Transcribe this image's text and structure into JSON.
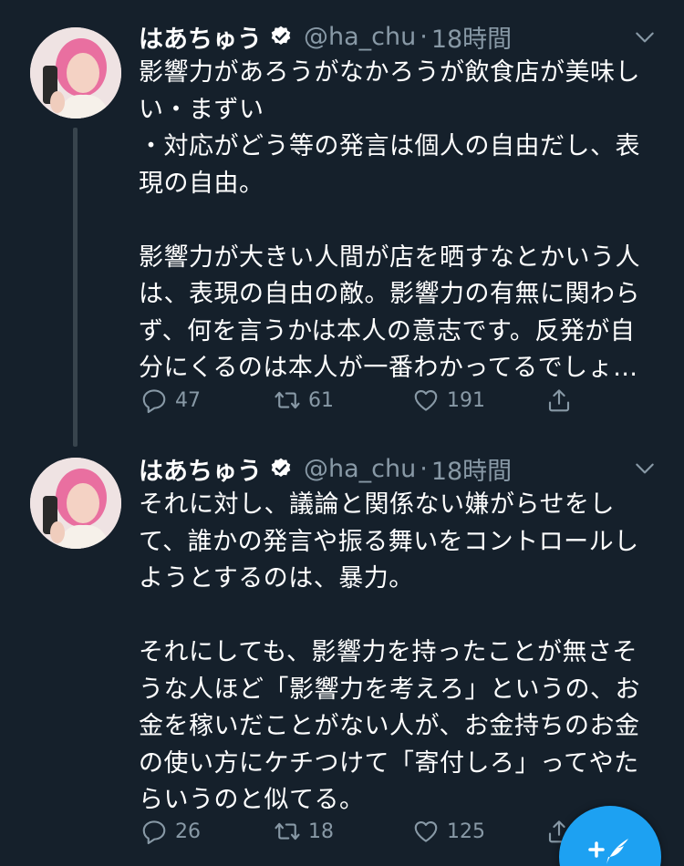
{
  "tweets": [
    {
      "display_name": "はあちゅう",
      "handle": "@ha_chu",
      "separator": "·",
      "time": "18時間",
      "text": "影響力があろうがなかろうが飲食店が美味しい・まずい\n・対応がどう等の発言は個人の自由だし、表現の自由。\n\n影響力が大きい人間が店を晒すなとかいう人は、表現の自由の敵。影響力の有無に関わらず、何を言うかは本人の意志です。反発が自分にくるのは本人が一番わかってるでしょ…",
      "reply_count": "47",
      "retweet_count": "61",
      "like_count": "191"
    },
    {
      "display_name": "はあちゅう",
      "handle": "@ha_chu",
      "separator": "·",
      "time": "18時間",
      "text": "それに対し、議論と関係ない嫌がらせをして、誰かの発言や振る舞いをコントロールしようとするのは、暴力。\n\nそれにしても、影響力を持ったことが無さそうな人ほど「影響力を考えろ」というの、お金を稼いだことがない人が、お金持ちのお金の使い方にケチつけて「寄付しろ」ってやたらいうのと似てる。",
      "reply_count": "26",
      "retweet_count": "18",
      "like_count": "125"
    }
  ],
  "icons": {
    "verified": "verified-badge-icon",
    "chevron": "chevron-down-icon",
    "reply": "reply-icon",
    "retweet": "retweet-icon",
    "like": "heart-icon",
    "share": "share-icon",
    "compose": "compose-tweet-icon"
  },
  "colors": {
    "background": "#15202b",
    "secondary_text": "#8899a6",
    "accent": "#1da1f2",
    "thread_line": "#38444d"
  }
}
